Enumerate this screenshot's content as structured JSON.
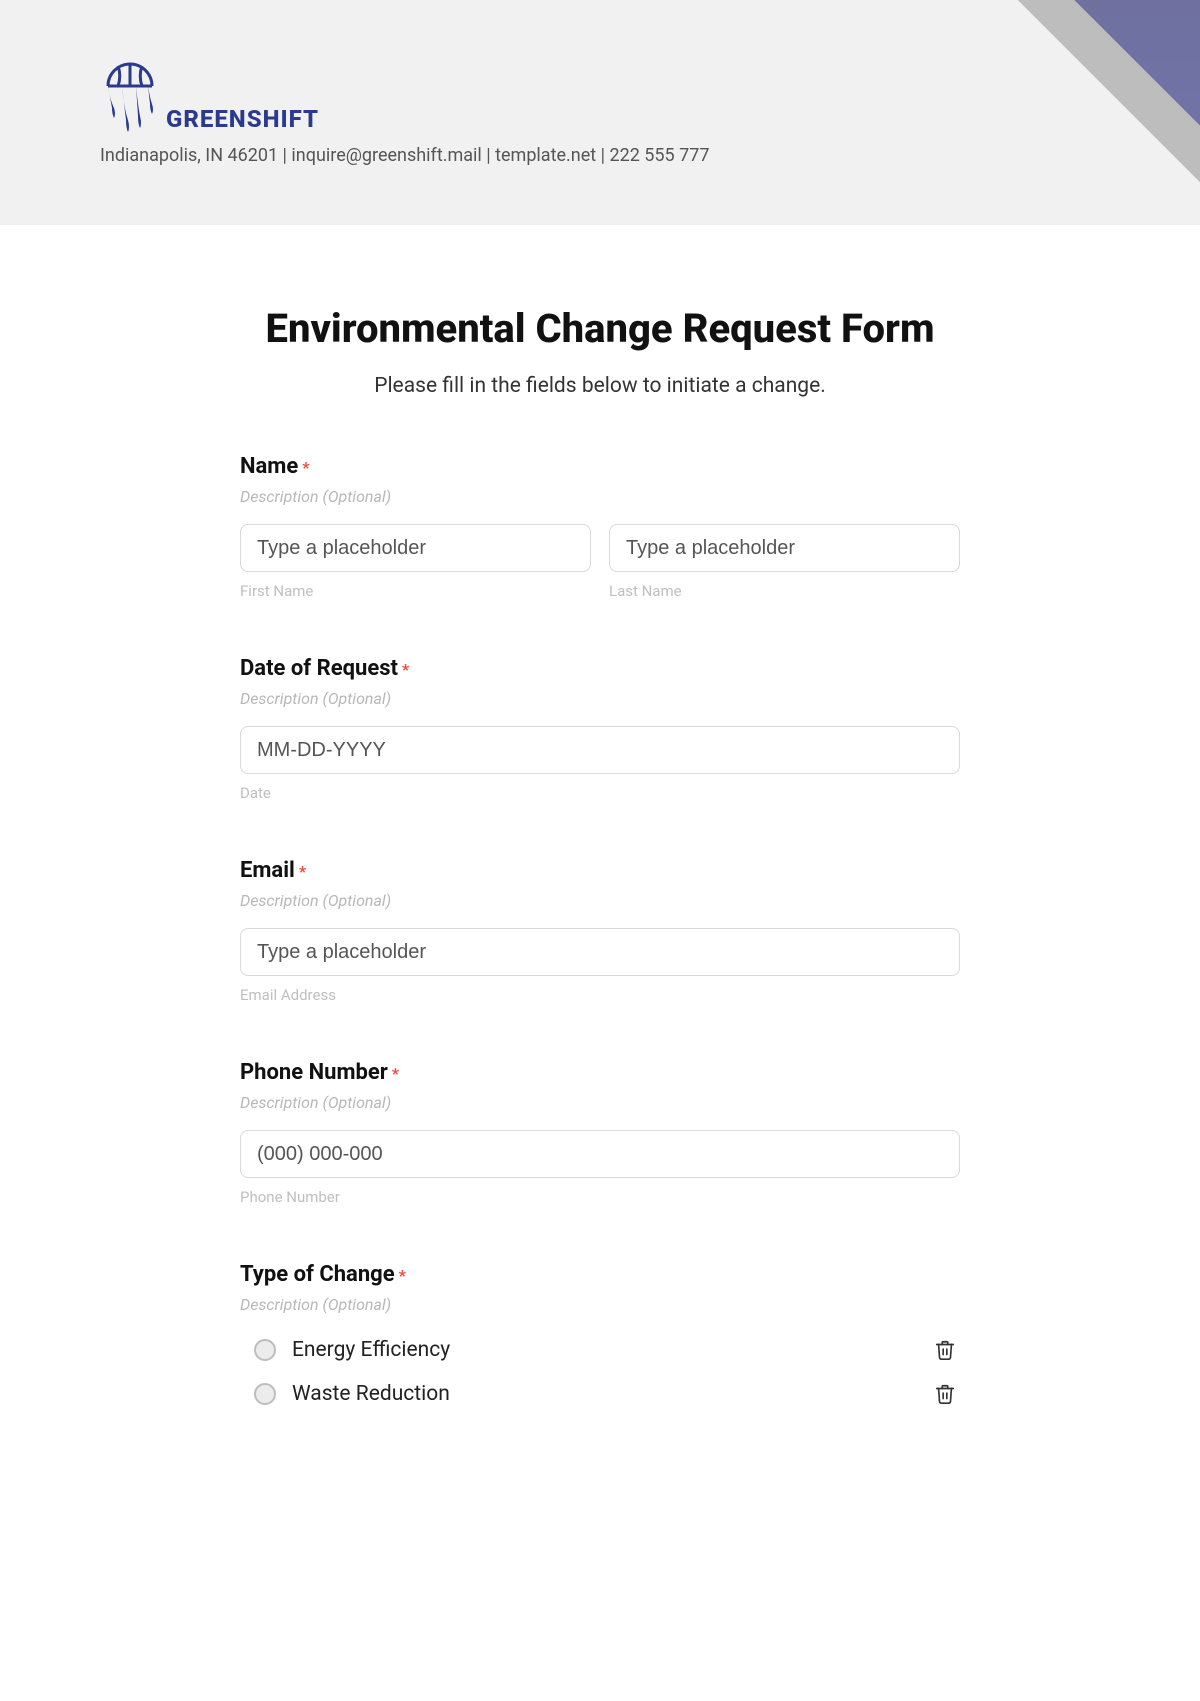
{
  "header": {
    "brand": "GREENSHIFT",
    "contact": "Indianapolis, IN 46201 | inquire@greenshift.mail | template.net | 222 555 777"
  },
  "form": {
    "title": "Environmental Change Request Form",
    "subtitle": "Please fill in the fields below to initiate a change.",
    "description_placeholder": "Description (Optional)",
    "required_mark": "*",
    "fields": {
      "name": {
        "label": "Name",
        "first_placeholder": "Type a placeholder",
        "last_placeholder": "Type a placeholder",
        "first_under": "First Name",
        "last_under": "Last Name"
      },
      "date": {
        "label": "Date of Request",
        "placeholder": "MM-DD-YYYY",
        "under": "Date"
      },
      "email": {
        "label": "Email",
        "placeholder": "Type a placeholder",
        "under": "Email Address"
      },
      "phone": {
        "label": "Phone Number",
        "placeholder": "(000) 000-000",
        "under": "Phone Number"
      },
      "type_of_change": {
        "label": "Type of Change",
        "options": [
          "Energy Efficiency",
          "Waste Reduction"
        ]
      }
    }
  }
}
